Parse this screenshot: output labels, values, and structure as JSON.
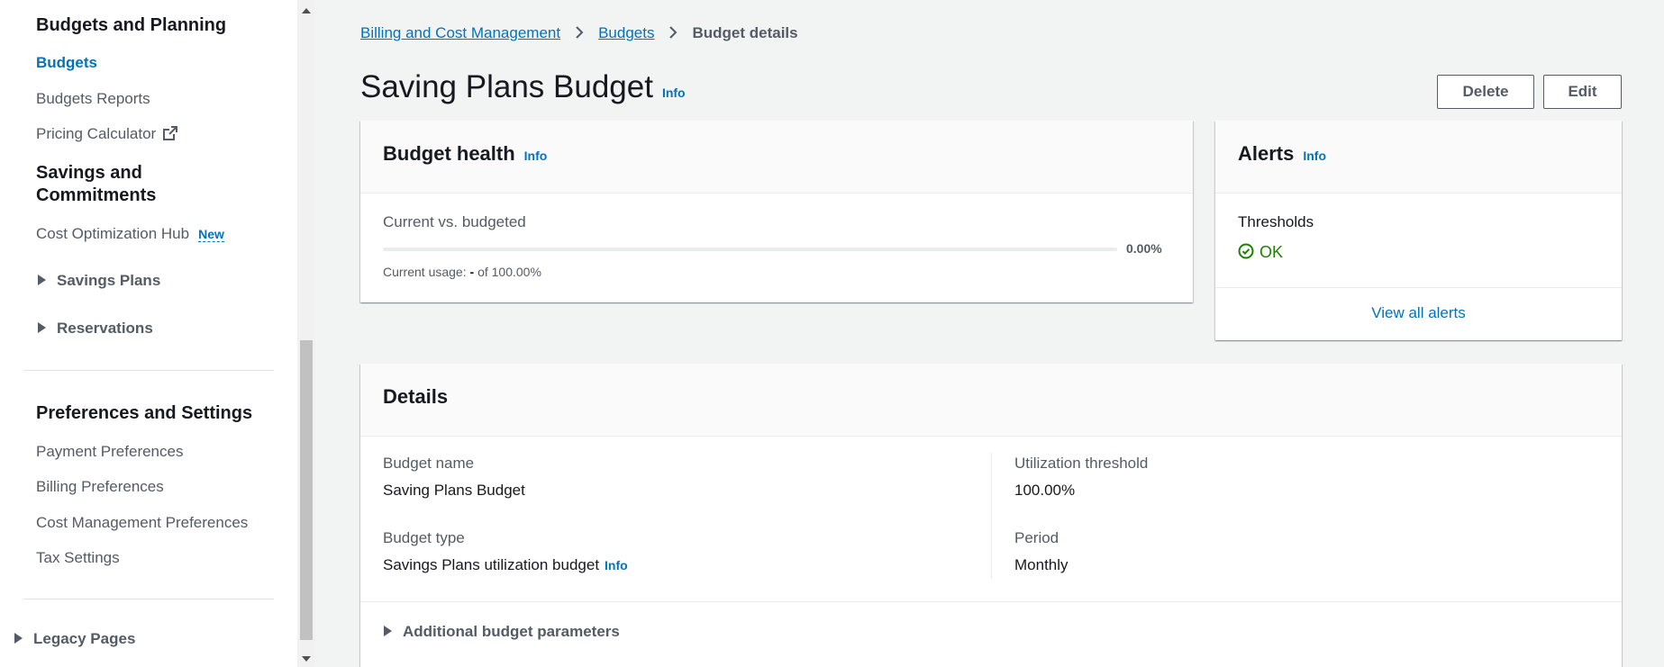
{
  "sidebar": {
    "section_budgets": "Budgets and Planning",
    "budgets": "Budgets",
    "budgets_reports": "Budgets Reports",
    "pricing_calculator": "Pricing Calculator",
    "section_savings": "Savings and Commitments",
    "cost_optimization_hub": "Cost Optimization Hub",
    "new_badge": "New",
    "savings_plans": "Savings Plans",
    "reservations": "Reservations",
    "section_preferences": "Preferences and Settings",
    "payment_preferences": "Payment Preferences",
    "billing_preferences": "Billing Preferences",
    "cost_management_preferences": "Cost Management Preferences",
    "tax_settings": "Tax Settings",
    "legacy_pages": "Legacy Pages"
  },
  "breadcrumb": {
    "item1": "Billing and Cost Management",
    "item2": "Budgets",
    "current": "Budget details"
  },
  "page": {
    "title": "Saving Plans Budget",
    "info": "Info",
    "delete_label": "Delete",
    "edit_label": "Edit"
  },
  "budget_health": {
    "title": "Budget health",
    "info": "Info",
    "label": "Current vs. budgeted",
    "percent": "0.00%",
    "progress_fraction": 0,
    "usage_prefix": "Current usage:",
    "usage_value": "-",
    "usage_suffix": "of 100.00%"
  },
  "alerts": {
    "title": "Alerts",
    "info": "Info",
    "thresholds_label": "Thresholds",
    "status": "OK",
    "view_all": "View all alerts"
  },
  "details": {
    "title": "Details",
    "budget_name_label": "Budget name",
    "budget_name_value": "Saving Plans Budget",
    "budget_type_label": "Budget type",
    "budget_type_value": "Savings Plans utilization budget",
    "budget_type_info": "Info",
    "utilization_threshold_label": "Utilization threshold",
    "utilization_threshold_value": "100.00%",
    "period_label": "Period",
    "period_value": "Monthly",
    "additional_params": "Additional budget parameters"
  },
  "colors": {
    "link": "#0073bb",
    "ok": "#1d8102",
    "text": "#16191f",
    "secondary": "#545b64",
    "background": "#f2f3f3"
  }
}
